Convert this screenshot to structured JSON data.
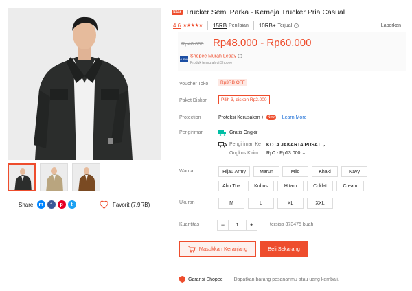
{
  "gallery": {
    "thumbnails": [
      "thumb-black",
      "thumb-khaki",
      "thumb-brown"
    ]
  },
  "share": {
    "label": "Share:",
    "icons": [
      "messenger-icon",
      "facebook-icon",
      "pinterest-icon",
      "twitter-icon"
    ]
  },
  "favorite": {
    "label": "Favorit (7,9RB)"
  },
  "product": {
    "badge": "Star",
    "title": "Trucker Semi Parka - Kemeja Trucker Pria Casual",
    "rating": "4.6",
    "stars": "★★★★★",
    "review_count": "15RB",
    "review_label": "Penilaian",
    "sold": "10RB+",
    "sold_label": "Terjual",
    "report": "Laporkan"
  },
  "price": {
    "original": "Rp48.000",
    "range": "Rp48.000 - Rp60.000",
    "promo_logo": "MURAH",
    "promo_name": "Shopee Murah Lebay",
    "promo_sub": "Produk termurah di Shopee"
  },
  "voucher": {
    "label": "Voucher Toko",
    "value": "Rp3RB OFF"
  },
  "bundle": {
    "label": "Paket Diskon",
    "value": "Pilih 3, diskon Rp2.000"
  },
  "protection": {
    "label": "Protection",
    "value": "Proteksi Kerusakan +",
    "new_badge": "New",
    "link": "Learn More"
  },
  "shipping": {
    "label": "Pengiriman",
    "free": "Gratis Ongkir",
    "to_label": "Pengiriman Ke",
    "to_value": "KOTA JAKARTA PUSAT",
    "cost_label": "Ongkos Kirim",
    "cost_value": "Rp0 - Rp13.000"
  },
  "color": {
    "label": "Warna",
    "options": [
      "Hijau Army",
      "Marun",
      "Milo",
      "Khaki",
      "Navy",
      "Abu Tua",
      "Kubus",
      "Hitam",
      "Coklat",
      "Cream"
    ]
  },
  "size": {
    "label": "Ukuran",
    "options": [
      "M",
      "L",
      "XL",
      "XXL"
    ]
  },
  "quantity": {
    "label": "Kuantitas",
    "minus": "−",
    "value": "1",
    "plus": "+",
    "stock": "tersisa 373475 buah"
  },
  "actions": {
    "cart": "Masukkan Keranjang",
    "buy": "Beli Sekarang"
  },
  "guarantee": {
    "title": "Garansi Shopee",
    "desc": "Dapatkan barang pesananmu atau uang kembali."
  },
  "colors": {
    "accent": "#ee4d2d",
    "link": "#1d6fd6"
  }
}
